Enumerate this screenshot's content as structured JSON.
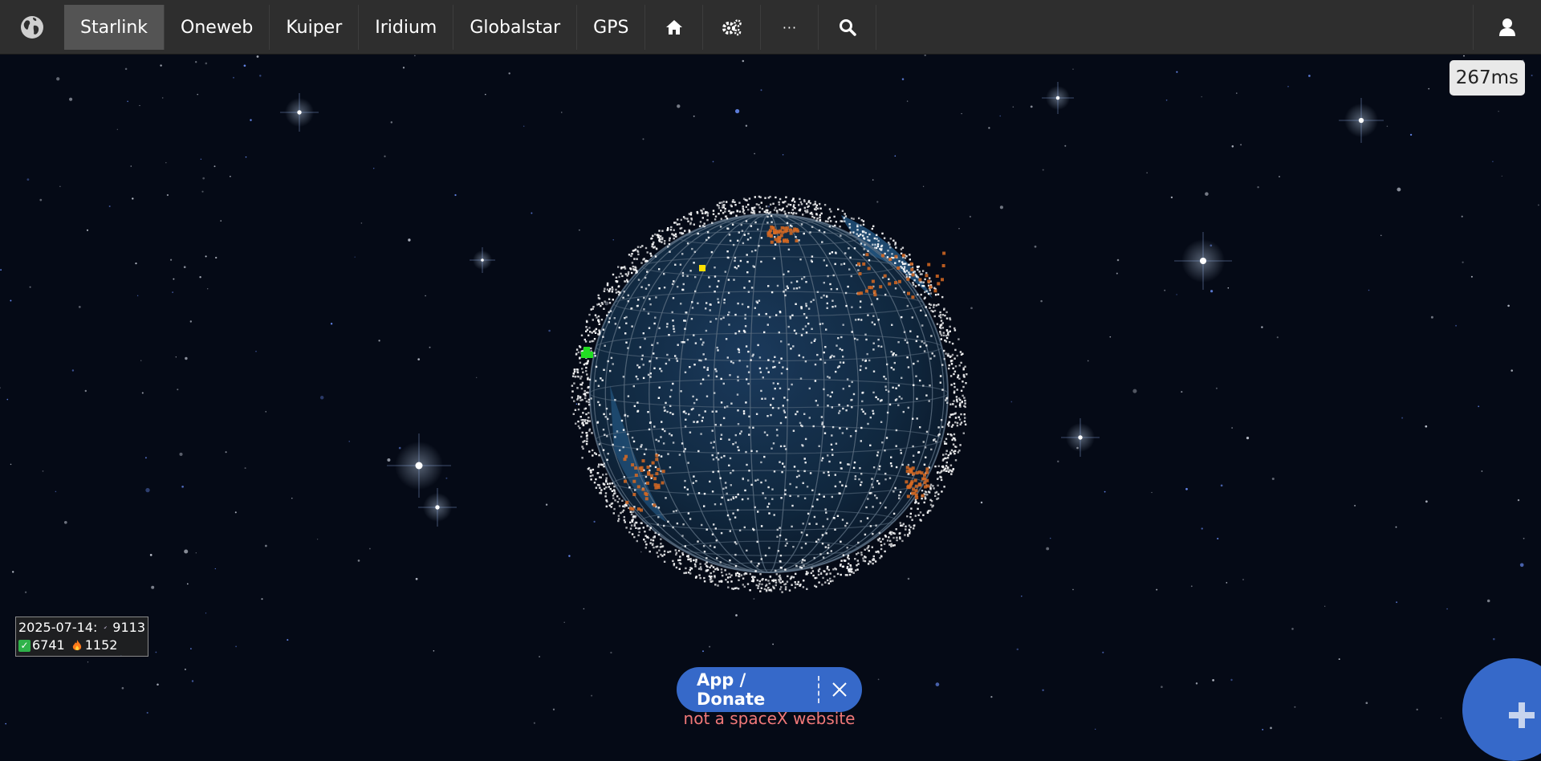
{
  "nav": {
    "items": [
      {
        "label": "Starlink",
        "active": true
      },
      {
        "label": "Oneweb"
      },
      {
        "label": "Kuiper"
      },
      {
        "label": "Iridium"
      },
      {
        "label": "Globalstar"
      },
      {
        "label": "GPS"
      }
    ],
    "icons": [
      "home-icon",
      "gears-icon",
      "ellipsis-icon",
      "search-icon"
    ],
    "more_label": "···",
    "logo_icon": "globe-icon",
    "user_icon": "user-icon"
  },
  "latency": "267ms",
  "stats": {
    "date": "2025-07-14:",
    "total": "9113",
    "active": "6741",
    "decayed": "1152",
    "icons": [
      "satellite-icon",
      "check-icon",
      "fire-icon"
    ]
  },
  "donate": {
    "label": "App / Donate",
    "note": "not a spaceX website"
  },
  "colors": {
    "navbar": "#2e2e2e",
    "accent": "#3669c9",
    "space": "#050a16",
    "satellite": "#ffffff",
    "decaying_satellite": "#d86a22",
    "selected_satellite": "#ffe000",
    "launch_train": "#22dd22",
    "note": "#f07878"
  }
}
